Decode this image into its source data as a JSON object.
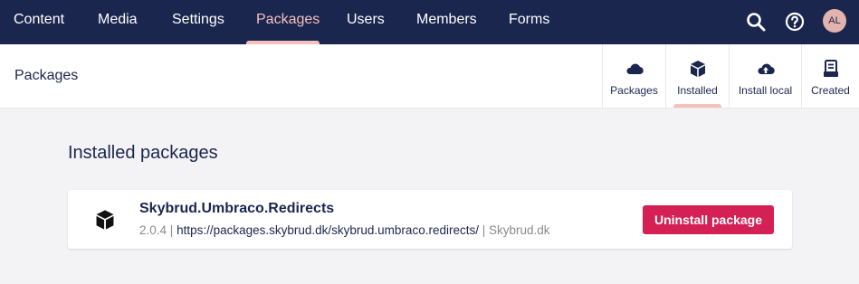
{
  "topnav": {
    "items": [
      {
        "label": "Content"
      },
      {
        "label": "Media"
      },
      {
        "label": "Settings"
      },
      {
        "label": "Packages",
        "active": true
      },
      {
        "label": "Users"
      },
      {
        "label": "Members"
      },
      {
        "label": "Forms"
      }
    ],
    "icons": [
      "search-icon",
      "help-icon"
    ],
    "avatar_initials": "AL"
  },
  "header": {
    "title": "Packages",
    "subnav": [
      {
        "label": "Packages",
        "icon": "cloud-icon"
      },
      {
        "label": "Installed",
        "icon": "box-icon",
        "active": true
      },
      {
        "label": "Install local",
        "icon": "cloud-upload-icon"
      },
      {
        "label": "Created",
        "icon": "document-box-icon"
      }
    ]
  },
  "main": {
    "section_title": "Installed packages",
    "packages": [
      {
        "name": "Skybrud.Umbraco.Redirects",
        "version": "2.0.4",
        "url": "https://packages.skybrud.dk/skybrud.umbraco.redirects/",
        "author": "Skybrud.dk",
        "uninstall_label": "Uninstall package"
      }
    ]
  },
  "colors": {
    "topbar": "#1b264f",
    "accent": "#f5c1bc",
    "danger": "#d42054"
  }
}
